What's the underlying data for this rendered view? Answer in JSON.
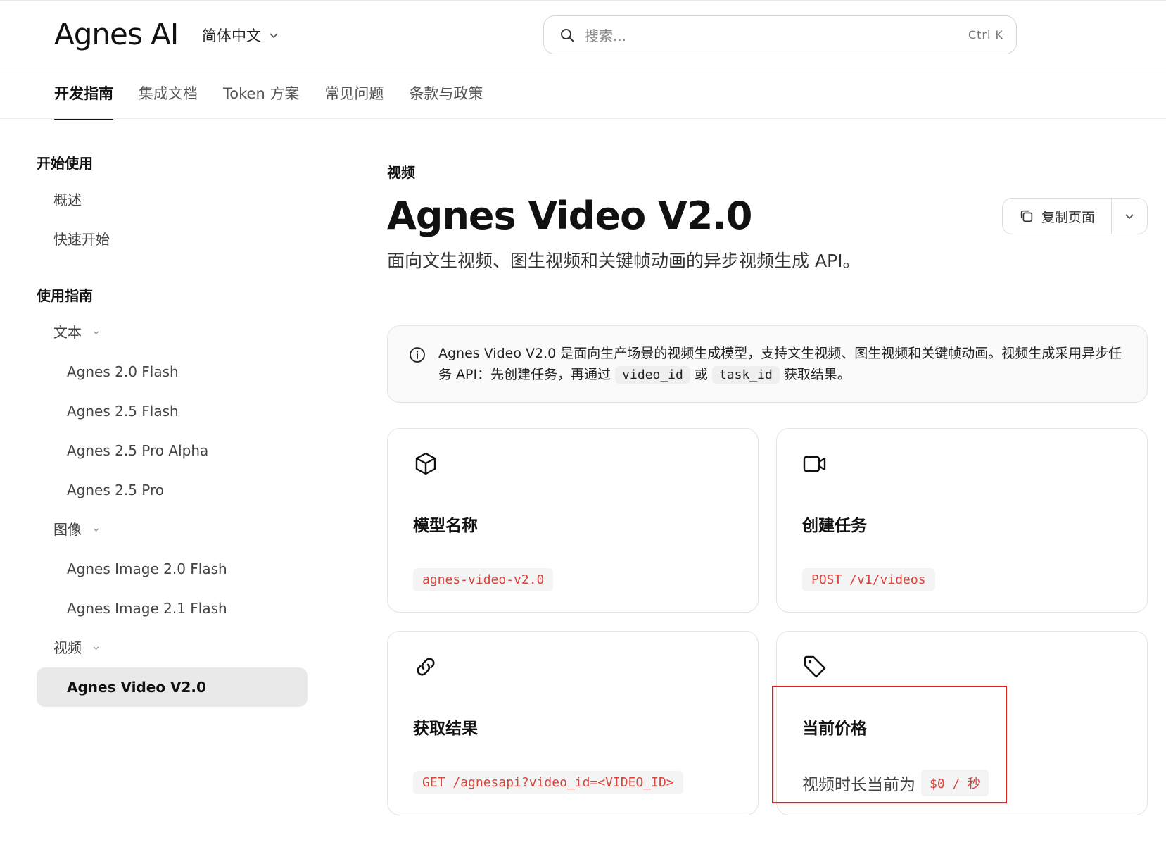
{
  "header": {
    "logo": "Agnes AI",
    "language": "简体中文",
    "search_placeholder": "搜索...",
    "search_shortcut": "Ctrl K"
  },
  "tabs": [
    {
      "label": "开发指南",
      "active": true
    },
    {
      "label": "集成文档",
      "active": false
    },
    {
      "label": "Token 方案",
      "active": false
    },
    {
      "label": "常见问题",
      "active": false
    },
    {
      "label": "条款与政策",
      "active": false
    }
  ],
  "sidebar": {
    "section_start": "开始使用",
    "overview": "概述",
    "quickstart": "快速开始",
    "section_guide": "使用指南",
    "group_text": "文本",
    "text_items": [
      "Agnes 2.0 Flash",
      "Agnes 2.5 Flash",
      "Agnes 2.5 Pro Alpha",
      "Agnes 2.5 Pro"
    ],
    "group_image": "图像",
    "image_items": [
      "Agnes Image 2.0 Flash",
      "Agnes Image 2.1 Flash"
    ],
    "group_video": "视频",
    "video_items": [
      "Agnes Video V2.0"
    ]
  },
  "main": {
    "eyebrow": "视频",
    "title": "Agnes Video V2.0",
    "subtitle": "面向文生视频、图生视频和关键帧动画的异步视频生成 API。",
    "copy_page": "复制页面",
    "callout": {
      "text_1": "Agnes Video V2.0 是面向生产场景的视频生成模型，支持文生视频、图生视频和关键帧动画。视频生成采用异步任务 API：先创建任务，再通过 ",
      "code_1": "video_id",
      "text_2": " 或 ",
      "code_2": "task_id",
      "text_3": " 获取结果。"
    },
    "cards": {
      "model": {
        "title": "模型名称",
        "code": "agnes-video-v2.0",
        "icon": "cube-icon"
      },
      "create": {
        "title": "创建任务",
        "code": "POST /v1/videos",
        "icon": "video-camera-icon"
      },
      "fetch": {
        "title": "获取结果",
        "code": "GET /agnesapi?video_id=<VIDEO_ID>",
        "icon": "link-icon"
      },
      "price": {
        "title": "当前价格",
        "text": "视频时长当前为",
        "code": "$0 / 秒",
        "icon": "tag-icon"
      }
    }
  },
  "colors": {
    "accent_code": "#d9443b",
    "highlight": "#e02020"
  }
}
